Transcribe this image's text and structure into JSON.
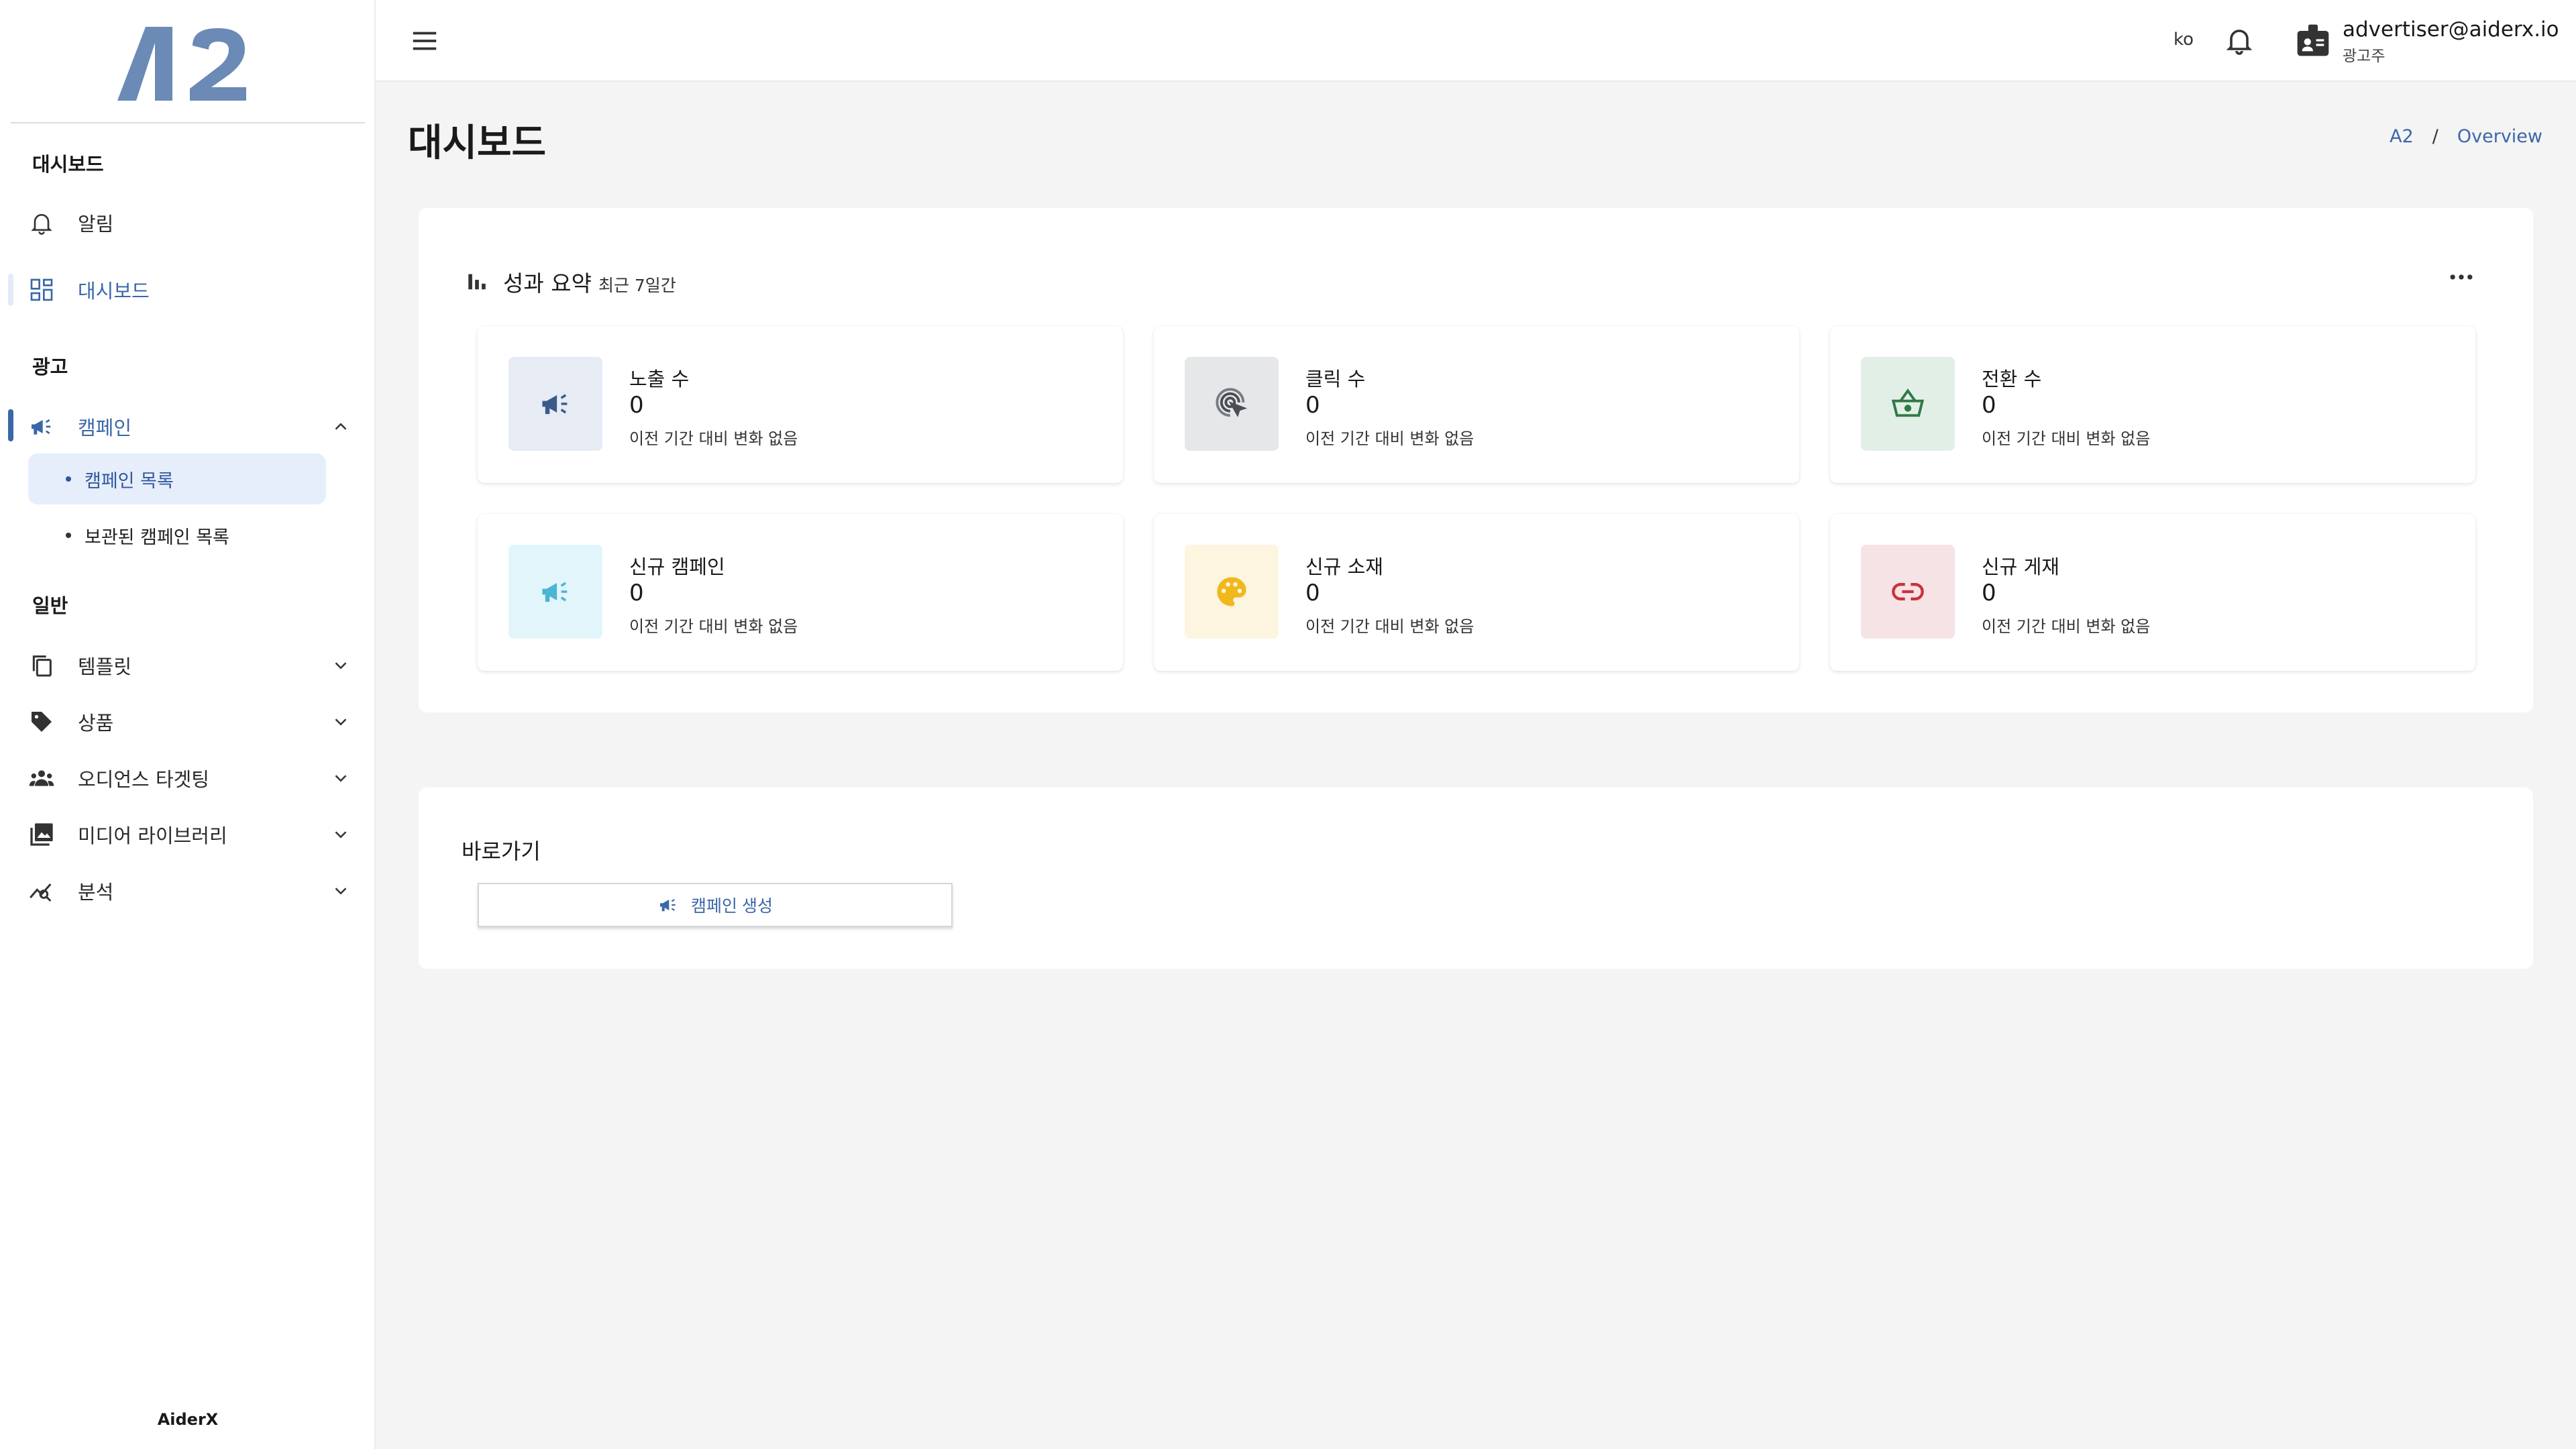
{
  "logo": {
    "text": "A2"
  },
  "sidebar": {
    "sections": [
      {
        "title": "대시보드"
      },
      {
        "title": "광고"
      },
      {
        "title": "일반"
      }
    ],
    "items": [
      {
        "label": "알림",
        "icon": "bell-icon"
      },
      {
        "label": "대시보드",
        "icon": "dashboard-grid-icon"
      },
      {
        "label": "캠페인",
        "icon": "megaphone-icon"
      },
      {
        "label": "템플릿",
        "icon": "copy-icon"
      },
      {
        "label": "상품",
        "icon": "tag-icon"
      },
      {
        "label": "오디언스 타겟팅",
        "icon": "people-icon"
      },
      {
        "label": "미디어 라이브러리",
        "icon": "photo-library-icon"
      },
      {
        "label": "분석",
        "icon": "analytics-icon"
      }
    ],
    "subitems": [
      {
        "label": "캠페인 목록"
      },
      {
        "label": "보관된 캠페인 목록"
      }
    ],
    "footer": "AiderX"
  },
  "topbar": {
    "lang": "ko",
    "user_email": "advertiser@aiderx.io",
    "user_role": "광고주"
  },
  "page": {
    "title": "대시보드",
    "breadcrumb": [
      "A2",
      "/",
      "Overview"
    ]
  },
  "summary": {
    "title": "성과 요약",
    "subtitle": "최근 7일간",
    "cards": [
      {
        "label": "노출 수",
        "value": "0",
        "note": "이전 기간 대비 변화 없음",
        "icon": "megaphone-icon",
        "bg": "#e6ebf4",
        "fg": "#3b5a8c"
      },
      {
        "label": "클릭 수",
        "value": "0",
        "note": "이전 기간 대비 변화 없음",
        "icon": "click-icon",
        "bg": "#e5e7e9",
        "fg": "#4a4f55"
      },
      {
        "label": "전환 수",
        "value": "0",
        "note": "이전 기간 대비 변화 없음",
        "icon": "basket-icon",
        "bg": "#e2efe6",
        "fg": "#2f7a46"
      },
      {
        "label": "신규 캠페인",
        "value": "0",
        "note": "이전 기간 대비 변화 없음",
        "icon": "megaphone-icon",
        "bg": "#e2f5fb",
        "fg": "#4cb4d4"
      },
      {
        "label": "신규 소재",
        "value": "0",
        "note": "이전 기간 대비 변화 없음",
        "icon": "palette-icon",
        "bg": "#fdf5df",
        "fg": "#f1b81c"
      },
      {
        "label": "신규 게재",
        "value": "0",
        "note": "이전 기간 대비 변화 없음",
        "icon": "link-icon",
        "bg": "#f6e3e5",
        "fg": "#c9323d"
      }
    ]
  },
  "shortcuts": {
    "title": "바로가기",
    "buttons": [
      {
        "label": "캠페인 생성",
        "icon": "megaphone-icon"
      }
    ]
  },
  "colors": {
    "accent": "#3b67a8",
    "logo": "#6b8ab5"
  }
}
